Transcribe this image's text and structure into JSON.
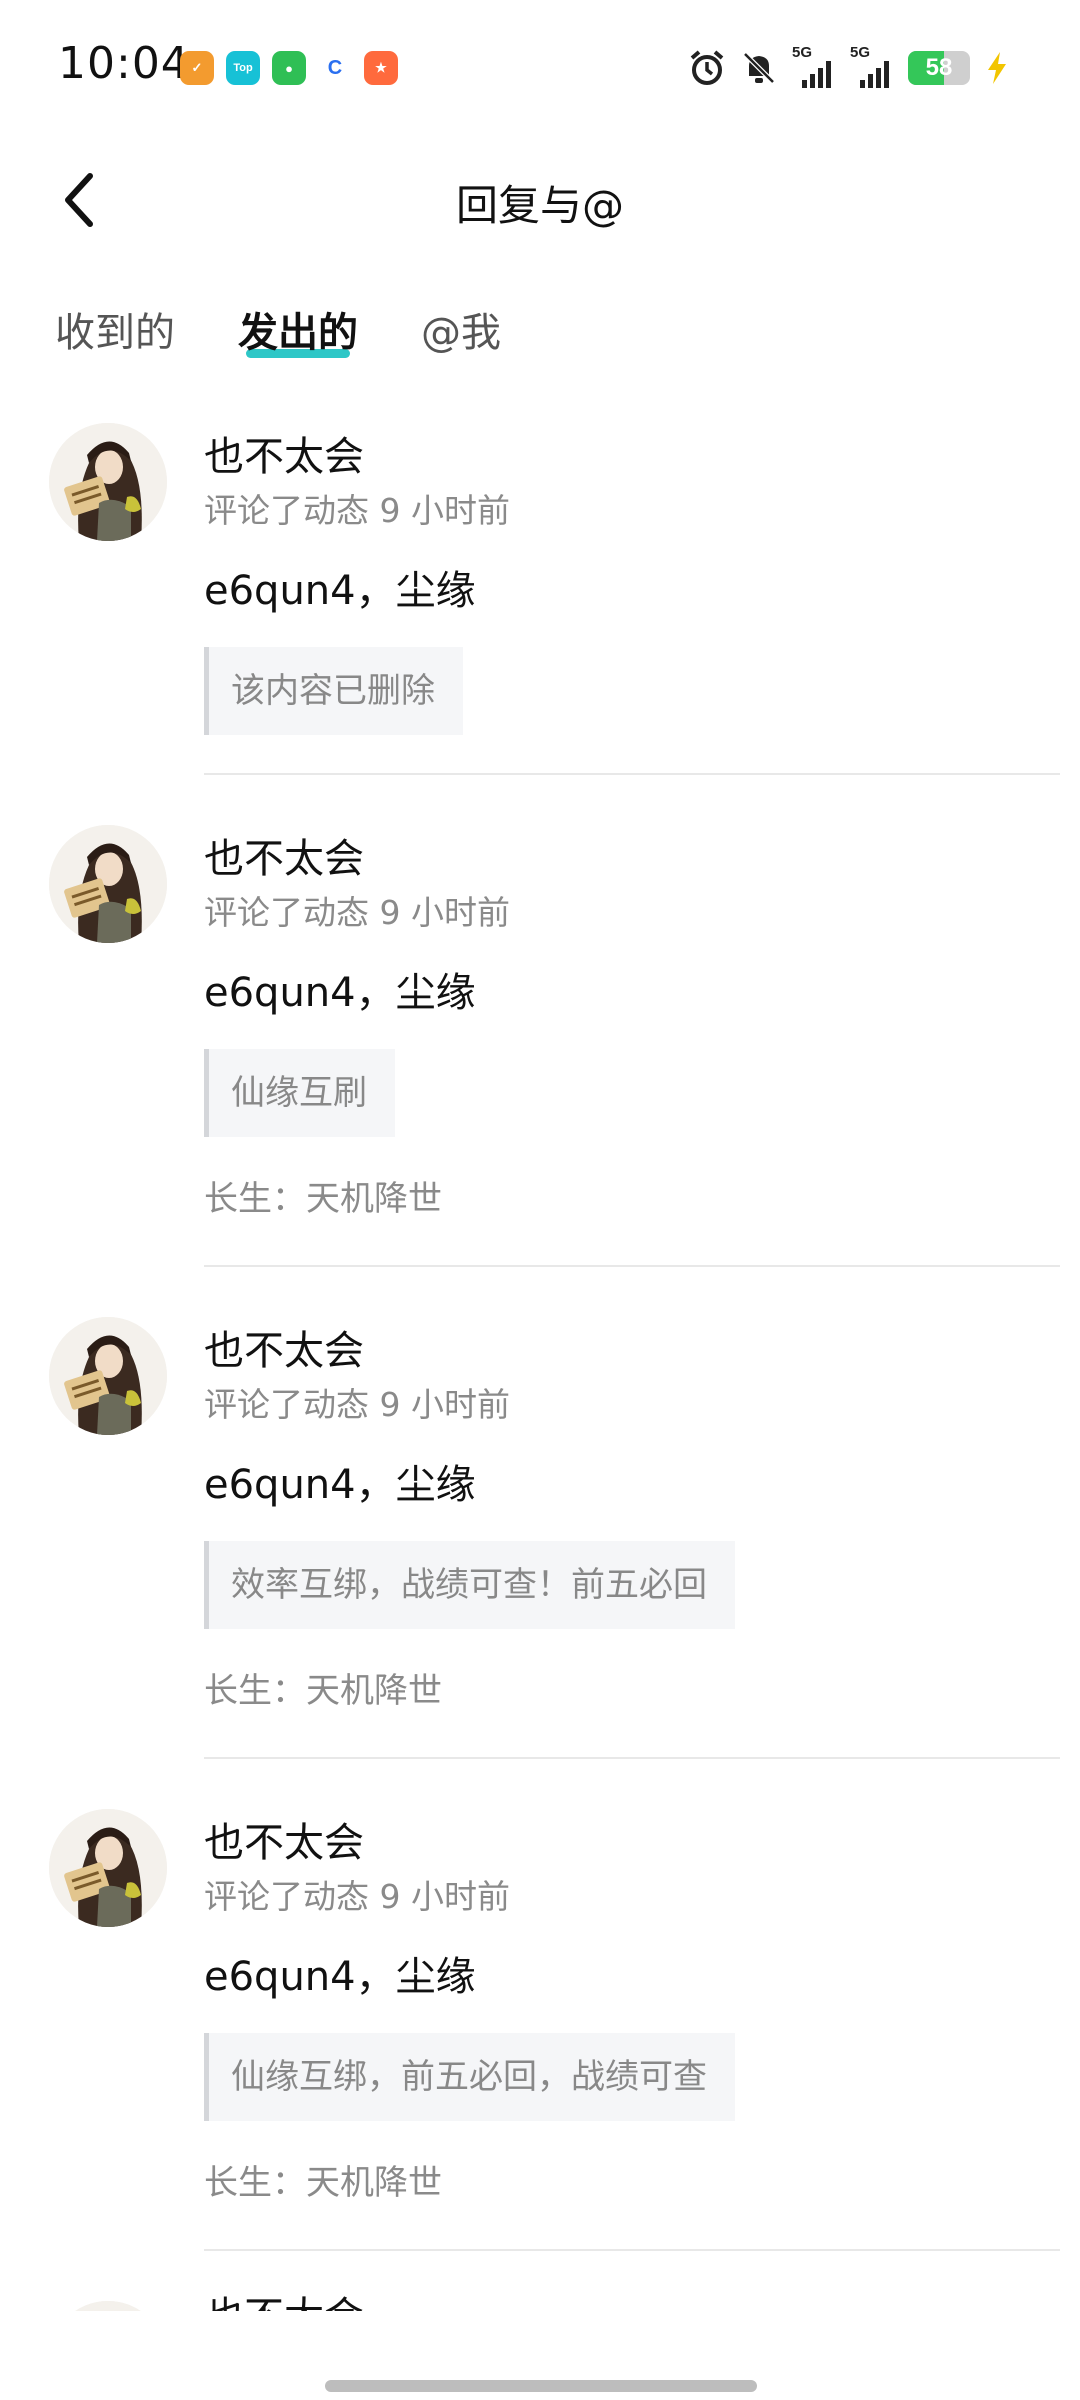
{
  "status_bar": {
    "time": "10:04",
    "apps": [
      {
        "name": "app-orange",
        "color": "#f39b2f",
        "glyph": "✓"
      },
      {
        "name": "app-top",
        "color": "#17c1d6",
        "glyph": "Top"
      },
      {
        "name": "app-wechat",
        "color": "#2fbf55",
        "glyph": "●"
      },
      {
        "name": "app-blue",
        "color": "#2a6ff0",
        "glyph": "C"
      },
      {
        "name": "app-red",
        "color": "#ff6a3d",
        "glyph": "★"
      }
    ],
    "signal_1": "5G",
    "signal_2": "5G",
    "battery_level": "58"
  },
  "header": {
    "title": "回复与@"
  },
  "tabs": [
    {
      "label": "收到的",
      "active": false
    },
    {
      "label": "发出的",
      "active": true
    },
    {
      "label": "@我",
      "active": false
    }
  ],
  "items": [
    {
      "name": "也不太会",
      "meta": "评论了动态 9 小时前",
      "reply": "e6qun4，尘缘",
      "quote": "该内容已删除",
      "source": ""
    },
    {
      "name": "也不太会",
      "meta": "评论了动态 9 小时前",
      "reply": "e6qun4，尘缘",
      "quote": "仙缘互刷",
      "source": "长生：天机降世"
    },
    {
      "name": "也不太会",
      "meta": "评论了动态 9 小时前",
      "reply": "e6qun4，尘缘",
      "quote": "效率互绑，战绩可查！前五必回",
      "source": "长生：天机降世"
    },
    {
      "name": "也不太会",
      "meta": "评论了动态 9 小时前",
      "reply": "e6qun4，尘缘",
      "quote": "仙缘互绑，前五必回，战绩可查",
      "source": "长生：天机降世"
    },
    {
      "name": "也不太会",
      "meta": "",
      "reply": "",
      "quote": "",
      "source": ""
    }
  ]
}
